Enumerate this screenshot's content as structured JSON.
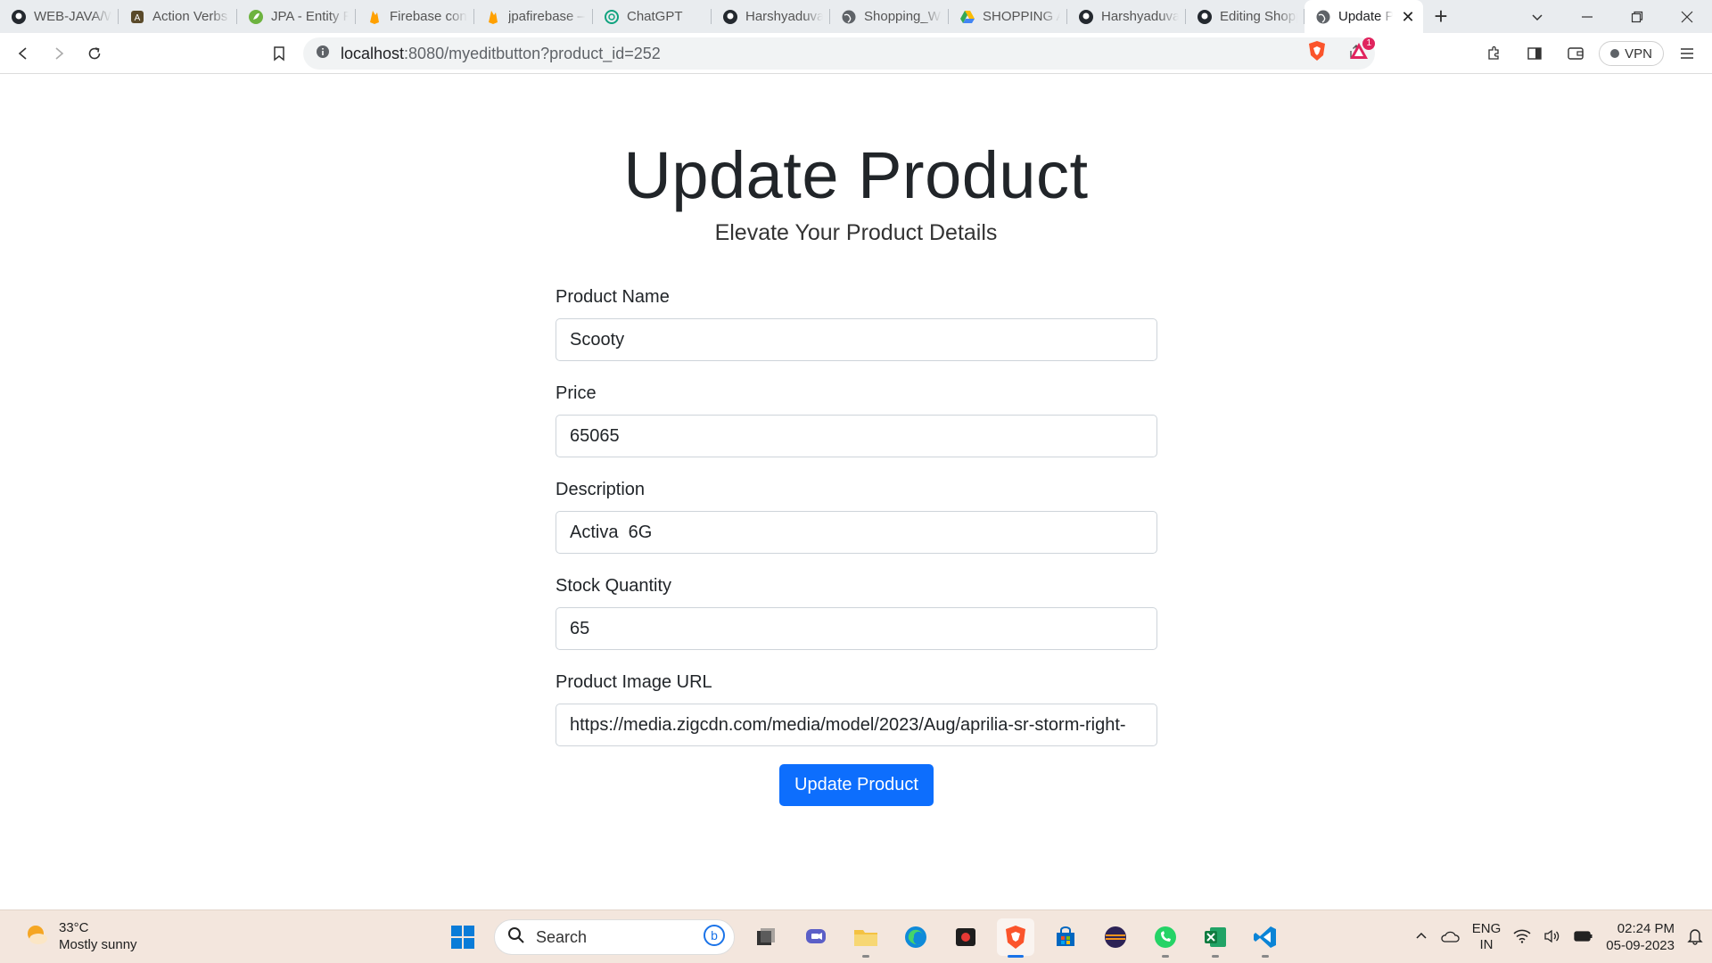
{
  "browser": {
    "tabs": [
      {
        "label": "WEB-JAVA/WEB",
        "icon": "github-icon"
      },
      {
        "label": "Action Verbs",
        "icon": "badge-icon"
      },
      {
        "label": "JPA - Entity Rela",
        "icon": "leaf-icon"
      },
      {
        "label": "Firebase console",
        "icon": "firebase-icon"
      },
      {
        "label": "jpafirebase – ",
        "icon": "firebase-icon"
      },
      {
        "label": "ChatGPT",
        "icon": "chatgpt-icon"
      },
      {
        "label": "Harshyaduvans",
        "icon": "github-icon"
      },
      {
        "label": "Shopping_Web",
        "icon": "globe-icon"
      },
      {
        "label": "SHOPPING APP",
        "icon": "drive-icon"
      },
      {
        "label": "Harshyaduvans",
        "icon": "github-icon"
      },
      {
        "label": "Editing Shopping",
        "icon": "github-icon"
      },
      {
        "label": "Update Product",
        "icon": "globe-icon",
        "active": true
      }
    ],
    "url_host": "localhost",
    "url_path": ":8080/myeditbutton?product_id=252",
    "vpn_label": "VPN",
    "alert_count": "1"
  },
  "page": {
    "title": "Update Product",
    "subtitle": "Elevate Your Product Details"
  },
  "form": {
    "product_name": {
      "label": "Product Name",
      "value": "Scooty"
    },
    "price": {
      "label": "Price",
      "value": "65065"
    },
    "description": {
      "label": "Description",
      "value": "Activa  6G"
    },
    "stock_quantity": {
      "label": "Stock Quantity",
      "value": "65"
    },
    "image_url": {
      "label": "Product Image URL",
      "value": "https://media.zigcdn.com/media/model/2023/Aug/aprilia-sr-storm-right-"
    },
    "submit_label": "Update Product"
  },
  "taskbar": {
    "weather_temp": "33°C",
    "weather_desc": "Mostly sunny",
    "search_placeholder": "Search",
    "lang_top": "ENG",
    "lang_bottom": "IN",
    "time": "02:24 PM",
    "date": "05-09-2023"
  },
  "colors": {
    "primary": "#0d6efd",
    "taskbar_bg": "#f3e6dd",
    "tabstrip_bg": "#e9ecef"
  }
}
